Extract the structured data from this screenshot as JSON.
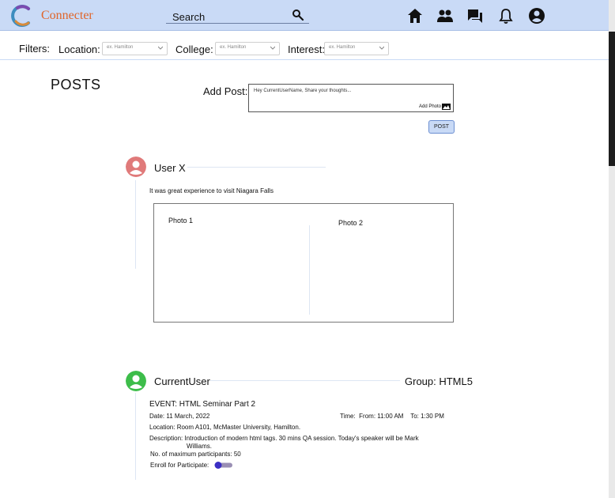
{
  "header": {
    "brand": "Connecter",
    "search_label": "Search",
    "icons": [
      "home-icon",
      "people-icon",
      "chat-icon",
      "bell-icon",
      "account-icon"
    ],
    "bg_color": "#c9daf6",
    "brand_color": "#e0652a"
  },
  "filters": {
    "label": "Filters:",
    "items": [
      {
        "label": "Location:",
        "placeholder": "ex. Hamilton"
      },
      {
        "label": "College:",
        "placeholder": "ex. Hamilton"
      },
      {
        "label": "Interest:",
        "placeholder": "ex. Hamilton"
      }
    ]
  },
  "posts": {
    "title": "POSTS",
    "add_post_label": "Add Post:",
    "add_post_placeholder": "Hey CurrentUserName, Share your thoughts...",
    "add_photo_label": "Add Photo",
    "post_button": "POST"
  },
  "feed": [
    {
      "user": "User X",
      "avatar_color": "#e07a7a",
      "text": "It was great experience to visit Niagara Falls",
      "photos": [
        "Photo 1",
        "Photo 2"
      ]
    },
    {
      "user": "CurrentUser",
      "avatar_color": "#3dbd4a",
      "group": "Group: HTML5",
      "event_title": "EVENT: HTML Seminar Part 2",
      "date": "Date: 11 March, 2022",
      "time": "Time:  From: 11:00 AM    To: 1:30 PM",
      "location": "Location: Room A101, McMaster University, Hamilton.",
      "description_line1": "Description: Introduction of modern html tags. 30 mins QA session. Today's speaker will be Mark",
      "description_line2": "Williams.",
      "max_participants": "No. of maximum participants: 50",
      "enroll_label": "Enroll for Participate:",
      "enroll_on": false
    }
  ]
}
